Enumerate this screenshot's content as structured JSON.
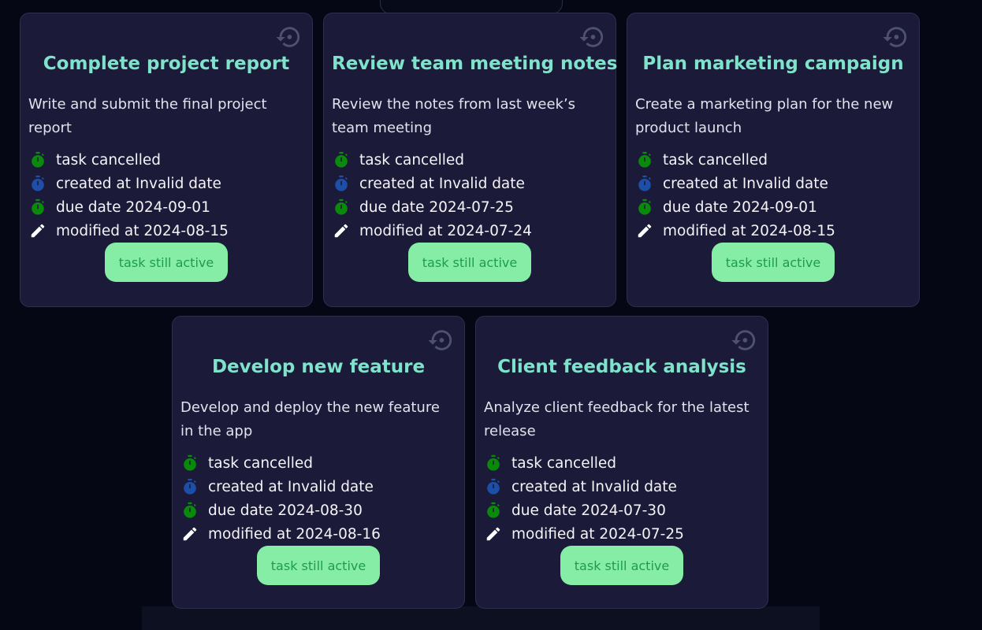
{
  "colors": {
    "background": "#050814",
    "card_background": "#1b1a38",
    "title": "#7fe3cc",
    "status_icon": "#0a8a0a",
    "created_icon": "#1e4fa8",
    "active_button_bg": "#86eda6",
    "active_button_text": "#1f9b50"
  },
  "icons": {
    "restore": "restore-history-icon",
    "status": "stopwatch-icon",
    "created": "stopwatch-icon",
    "due": "stopwatch-icon",
    "modified": "pencil-icon"
  },
  "tasks": [
    {
      "title": "Complete project report",
      "description": "Write and submit the final project report",
      "status": "task cancelled",
      "created": "created at Invalid date",
      "due": "due date 2024-09-01",
      "modified": "modified at 2024-08-15",
      "action_label": "task still active"
    },
    {
      "title": "Review team meeting notes",
      "description": "Review the notes from last week’s team meeting",
      "status": "task cancelled",
      "created": "created at Invalid date",
      "due": "due date 2024-07-25",
      "modified": "modified at 2024-07-24",
      "action_label": "task still active"
    },
    {
      "title": "Plan marketing campaign",
      "description": "Create a marketing plan for the new product launch",
      "status": "task cancelled",
      "created": "created at Invalid date",
      "due": "due date 2024-09-01",
      "modified": "modified at 2024-08-15",
      "action_label": "task still active"
    },
    {
      "title": "Develop new feature",
      "description": "Develop and deploy the new feature in the app",
      "status": "task cancelled",
      "created": "created at Invalid date",
      "due": "due date 2024-08-30",
      "modified": "modified at 2024-08-16",
      "action_label": "task still active"
    },
    {
      "title": "Client feedback analysis",
      "description": "Analyze client feedback for the latest release",
      "status": "task cancelled",
      "created": "created at Invalid date",
      "due": "due date 2024-07-30",
      "modified": "modified at 2024-07-25",
      "action_label": "task still active"
    }
  ]
}
